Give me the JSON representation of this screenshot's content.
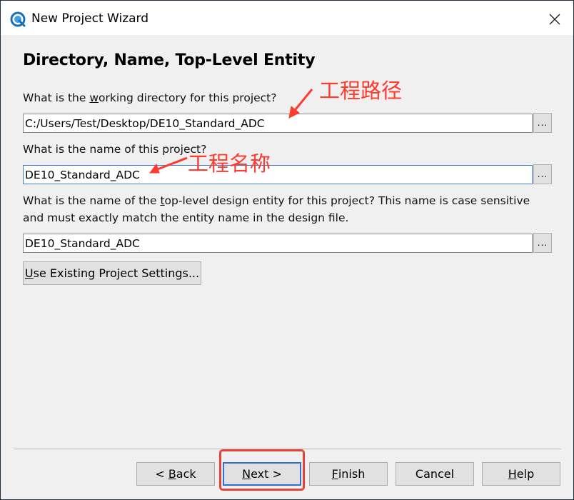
{
  "window": {
    "title": "New Project Wizard"
  },
  "page": {
    "heading": "Directory, Name, Top-Level Entity"
  },
  "fields": {
    "directory": {
      "label_before": "What is the ",
      "label_u": "w",
      "label_after": "orking directory for this project?",
      "value": "C:/Users/Test/Desktop/DE10_Standard_ADC",
      "browse": "..."
    },
    "name": {
      "label": "What is the name of this project?",
      "value": "DE10_Standard_ADC",
      "browse": "..."
    },
    "entity": {
      "label_line1_before": "What is the name of the ",
      "label_line1_u": "t",
      "label_line1_after": "op-level design entity for this project? This name is case sensitive",
      "label_line2": "and must exactly match the entity name in the design file.",
      "value": "DE10_Standard_ADC",
      "browse": "..."
    }
  },
  "buttons": {
    "use_existing_u": "U",
    "use_existing_rest": "se Existing Project Settings...",
    "back_pre": "< ",
    "back_u": "B",
    "back_rest": "ack",
    "next_u": "N",
    "next_rest": "ext >",
    "finish_u": "F",
    "finish_rest": "inish",
    "cancel": "Cancel",
    "help_u": "H",
    "help_rest": "elp"
  },
  "annotations": {
    "path_note": "工程路径",
    "name_note": "工程名称",
    "color": "#ff3b30"
  },
  "colors": {
    "accent": "#2e6fd0",
    "highlight": "#e8413a"
  }
}
